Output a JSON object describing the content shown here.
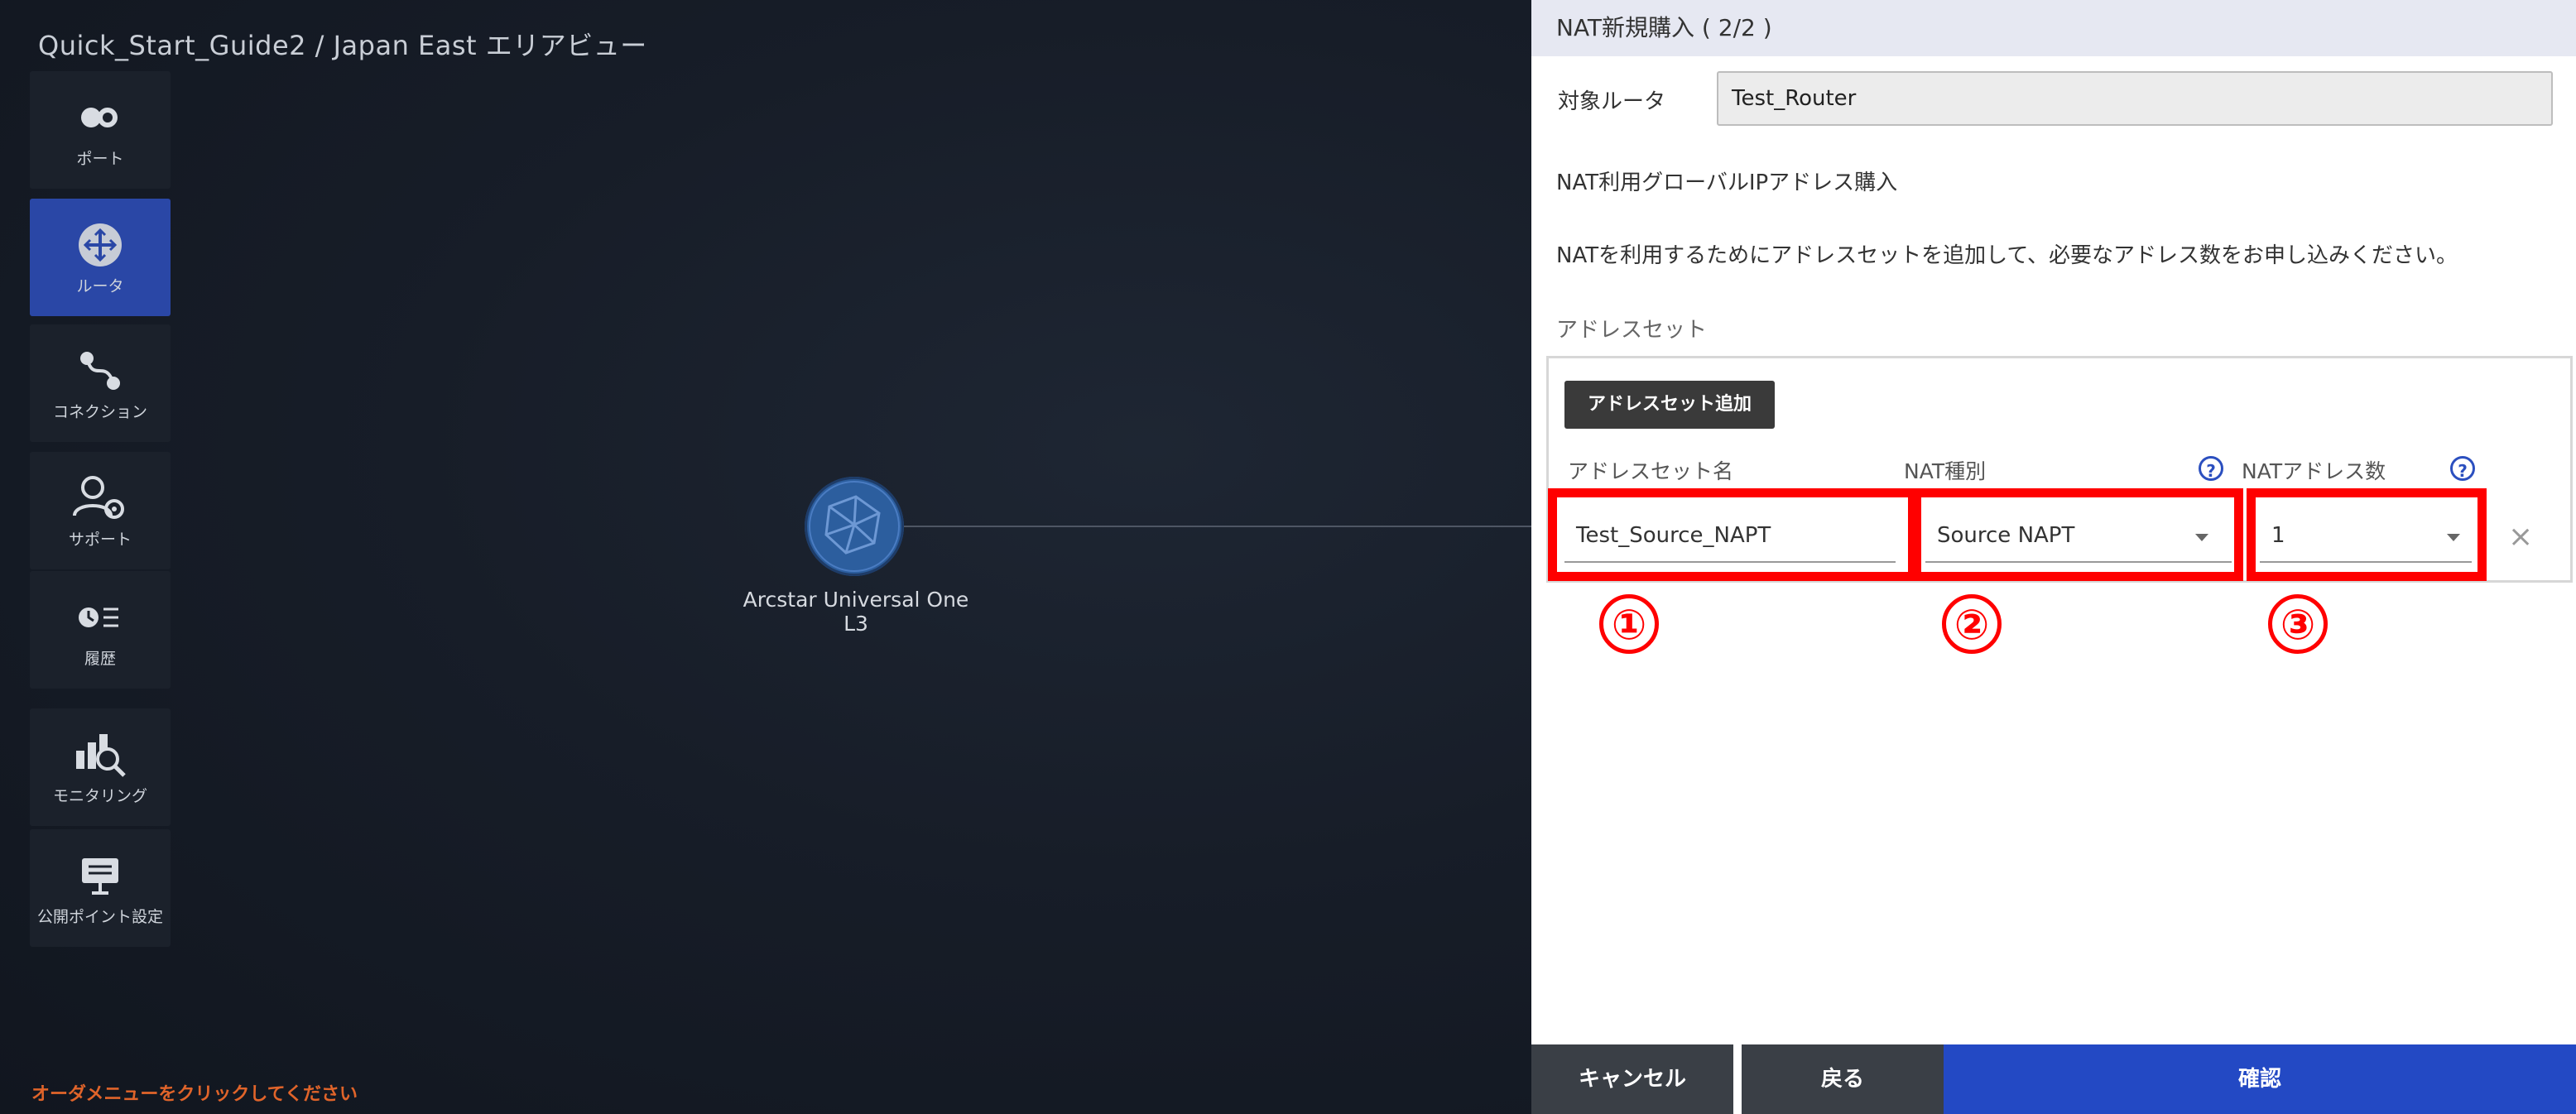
{
  "header": {
    "title": "Quick_Start_Guide2 / Japan East エリアビュー"
  },
  "sidebar": {
    "items": [
      {
        "label": "ポート",
        "icon": "port-icon"
      },
      {
        "label": "ルータ",
        "icon": "router-icon",
        "active": true
      },
      {
        "label": "コネクション",
        "icon": "connection-icon"
      },
      {
        "label": "サポート",
        "icon": "support-icon"
      },
      {
        "label": "履歴",
        "icon": "history-icon"
      },
      {
        "label": "モニタリング",
        "icon": "monitoring-icon"
      },
      {
        "label": "公開ポイント設定",
        "icon": "public-point-icon"
      }
    ]
  },
  "canvas": {
    "node_label": "Arcstar Universal One L3",
    "hint": "オーダメニューをクリックしてください"
  },
  "panel": {
    "title": "NAT新規購入 ( 2/2 )",
    "router_label": "対象ルータ",
    "router_value": "Test_Router",
    "section_title": "NAT利用グローバルIPアドレス購入",
    "description": "NATを利用するためにアドレスセットを追加して、必要なアドレス数をお申し込みください。",
    "address_set_label": "アドレスセット",
    "add_button": "アドレスセット追加",
    "columns": {
      "name": "アドレスセット名",
      "type": "NAT種別",
      "count": "NATアドレス数"
    },
    "row": {
      "name": "Test_Source_NAPT",
      "type": "Source NAPT",
      "count": "1"
    },
    "markers": [
      "①",
      "②",
      "③"
    ],
    "help_glyph": "?",
    "remove_glyph": "×"
  },
  "footer": {
    "cancel": "キャンセル",
    "back": "戻る",
    "confirm": "確認"
  },
  "colors": {
    "accent": "#2349c4",
    "highlight": "#ff0000",
    "hint": "#e0642a"
  }
}
